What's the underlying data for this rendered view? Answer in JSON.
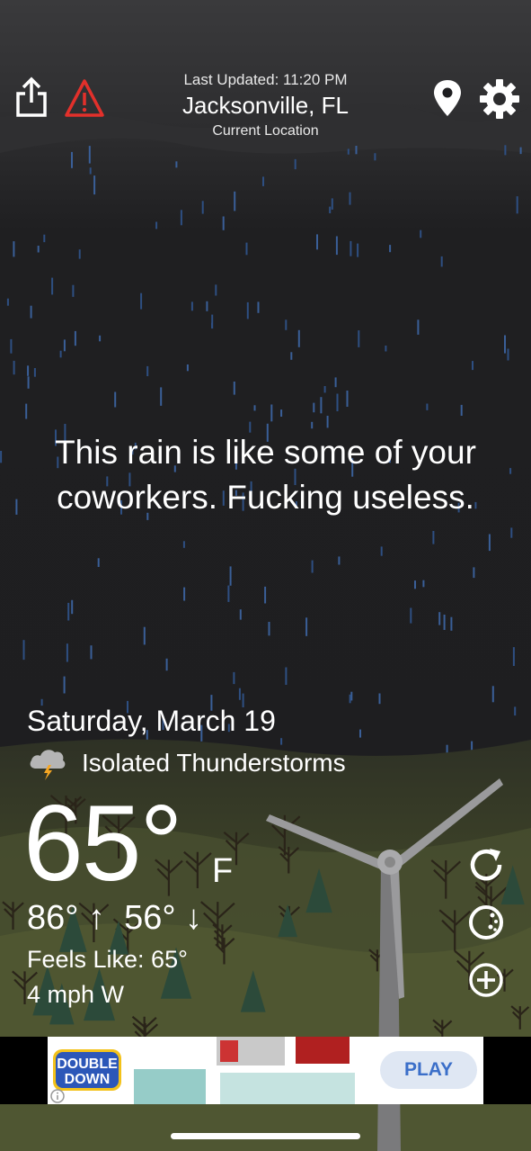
{
  "header": {
    "last_updated": "Last Updated: 11:20 PM",
    "city": "Jacksonville, FL",
    "location_label": "Current Location",
    "icons": [
      "share-icon",
      "alert-icon",
      "location-pin-icon",
      "gear-icon"
    ]
  },
  "quote": {
    "line1": "This rain is like some of your",
    "line2": "coworkers. Fucking useless."
  },
  "weather": {
    "date": "Saturday, March 19",
    "condition": "Isolated Thunderstorms",
    "condition_icon": "thunderstorm-icon",
    "temperature": "65°",
    "unit": "F",
    "hilo": "86° ↑  56° ↓",
    "feels_like": "Feels Like: 65°",
    "wind": "4 mph W"
  },
  "actions": {
    "icons": [
      "refresh-icon",
      "radar-icon",
      "add-icon"
    ]
  },
  "ad": {
    "logo_line1": "DOUBLE",
    "logo_line2": "DOWN",
    "play_label": "PLAY"
  },
  "colors": {
    "background": "#1e1e20",
    "rain": "#3a5f98",
    "ground": "#3d4227",
    "alert_red": "#e2302b",
    "play_text": "#3b6fc9"
  }
}
